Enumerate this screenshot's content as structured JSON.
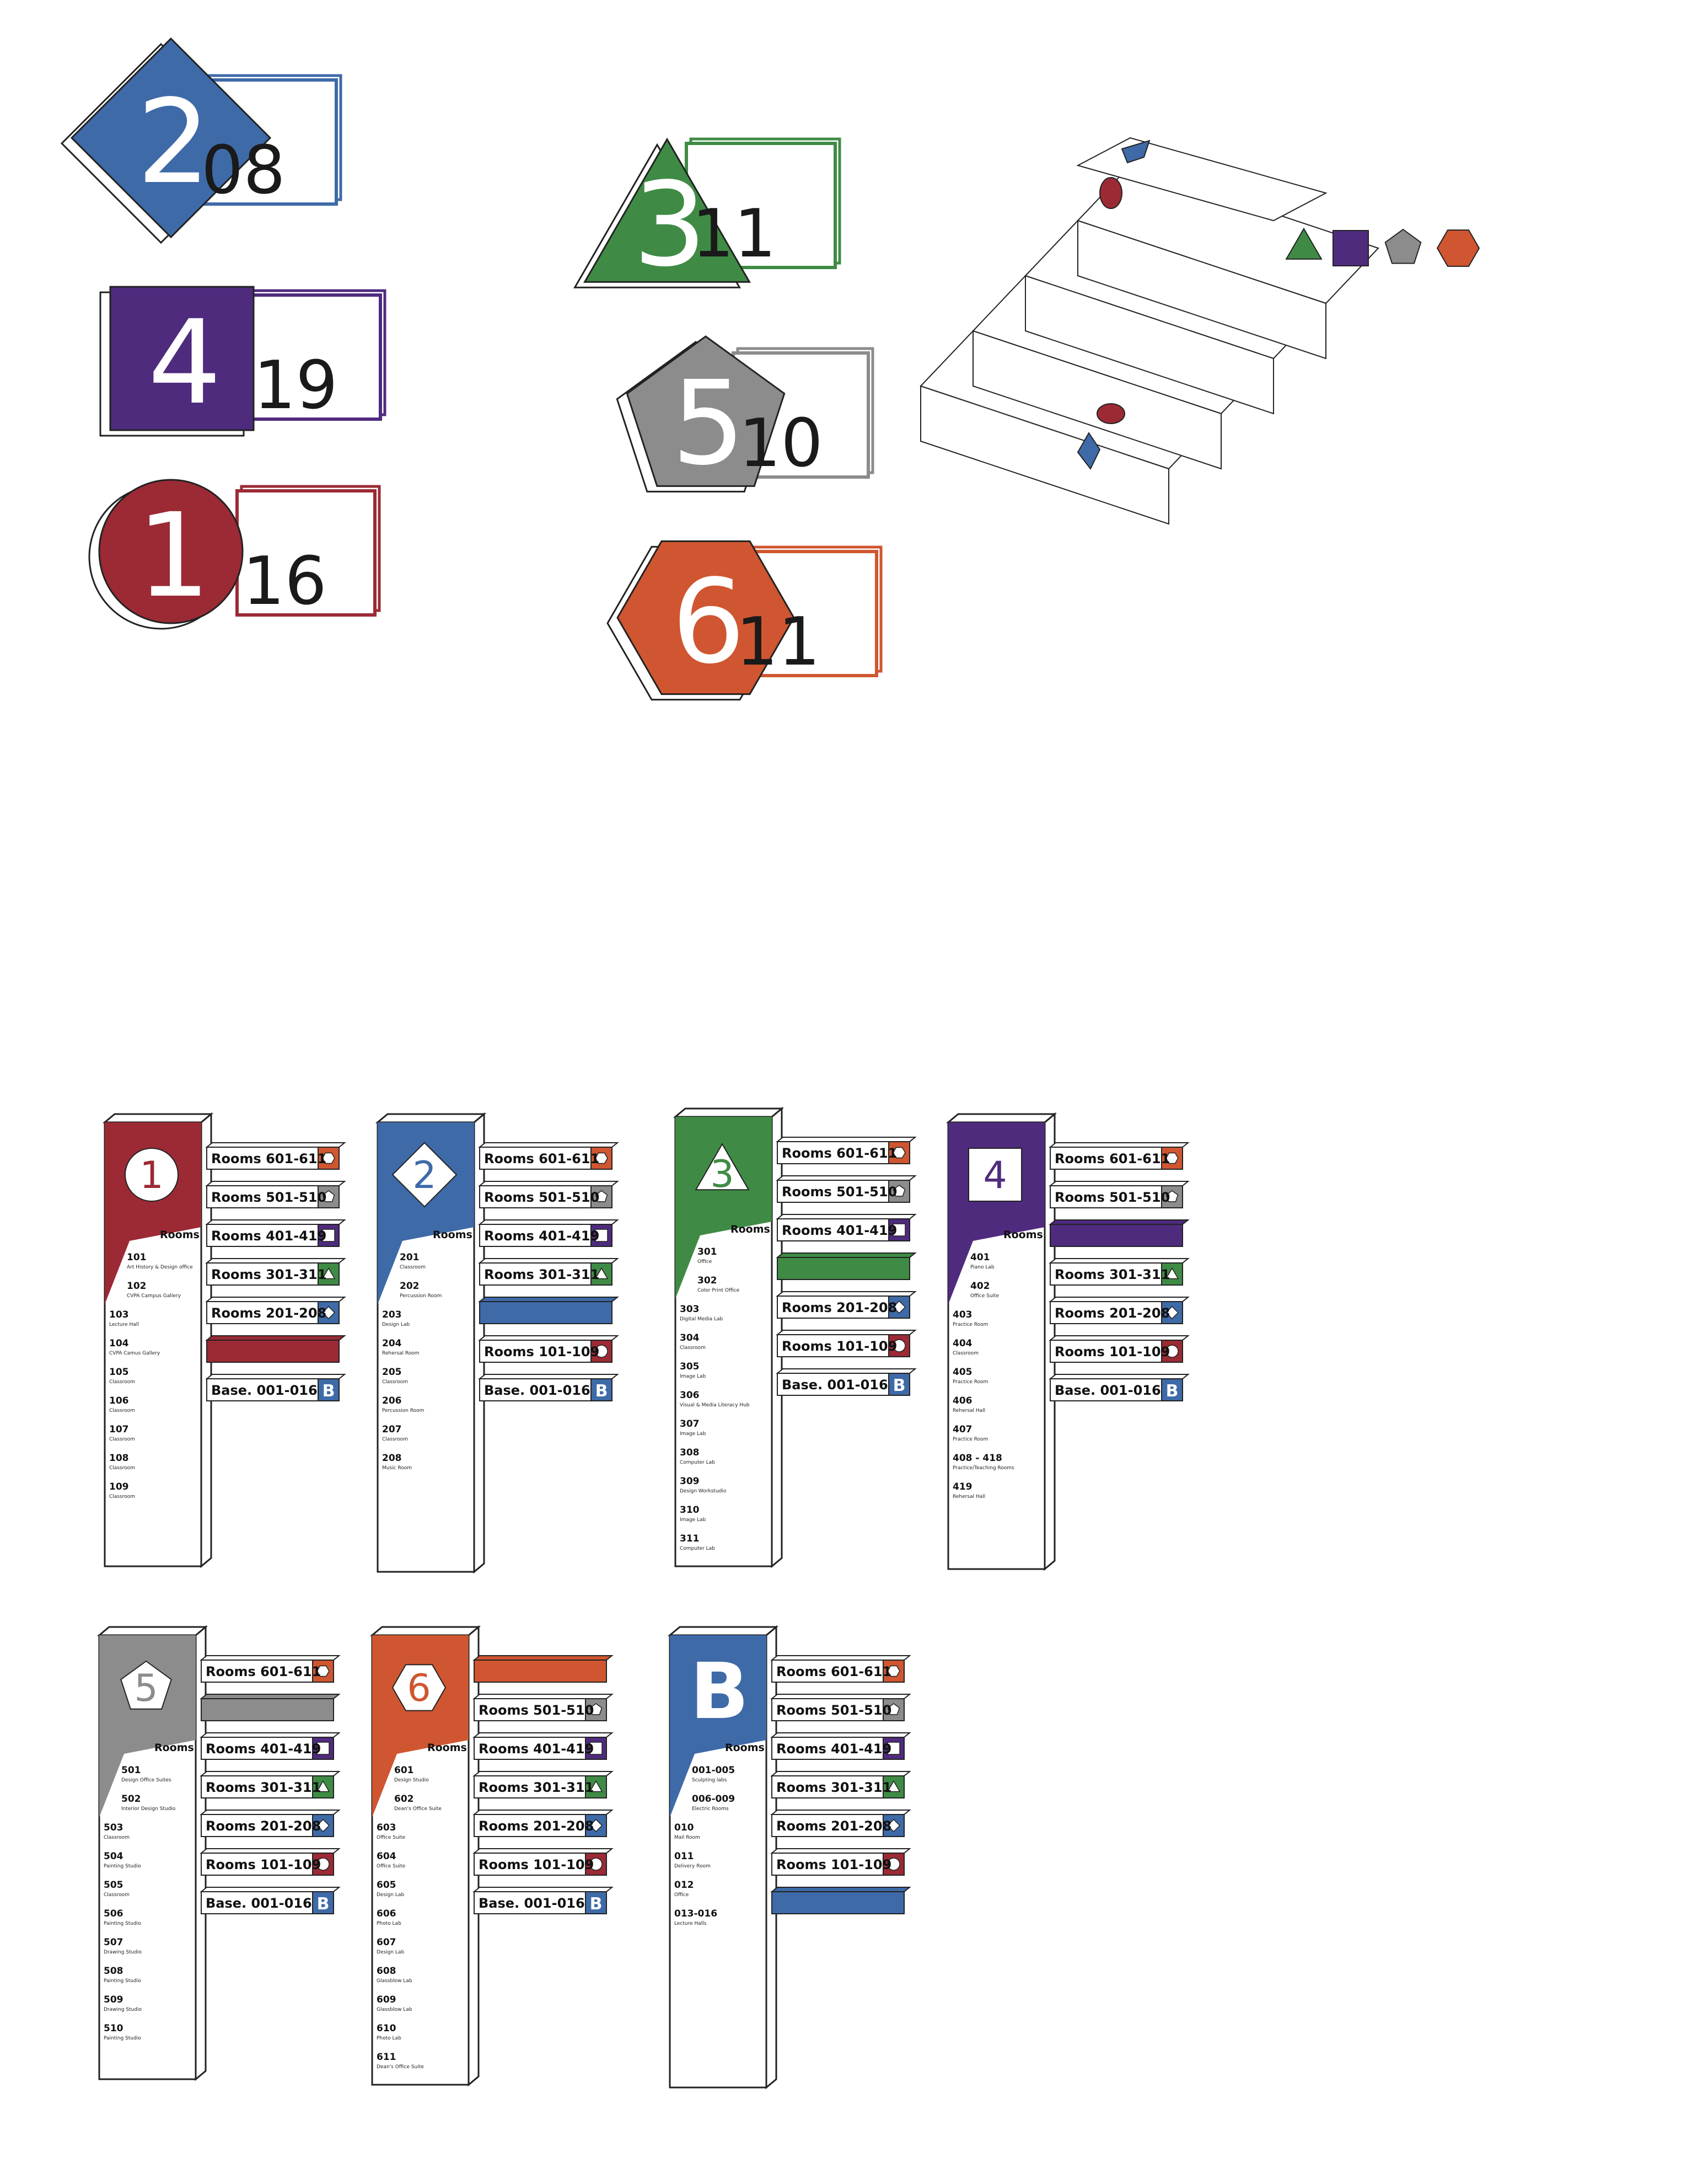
{
  "colors": {
    "floor1": "#9b2a35",
    "floor2": "#3e6aa8",
    "floor3": "#3f8b45",
    "floor4": "#4f2b7e",
    "floor5": "#8c8c8c",
    "floor6": "#cf5630",
    "basement": "#3e6aa8",
    "outline": "#222222"
  },
  "floor_badges": [
    {
      "floor": "2",
      "rooms": "08",
      "shape": "diamond",
      "color_key": "floor2"
    },
    {
      "floor": "4",
      "rooms": "19",
      "shape": "square",
      "color_key": "floor4"
    },
    {
      "floor": "1",
      "rooms": "16",
      "shape": "circle",
      "color_key": "floor1"
    },
    {
      "floor": "3",
      "rooms": "11",
      "shape": "triangle",
      "color_key": "floor3"
    },
    {
      "floor": "5",
      "rooms": "10",
      "shape": "pentagon",
      "color_key": "floor5"
    },
    {
      "floor": "6",
      "rooms": "11",
      "shape": "hexagon",
      "color_key": "floor6"
    }
  ],
  "stairs_legend": [
    "triangle",
    "square",
    "pentagon",
    "hexagon"
  ],
  "tab_labels": {
    "6": "Rooms 601-611",
    "5": "Rooms 501-510",
    "4": "Rooms 401-419",
    "3": "Rooms 301-311",
    "2": "Rooms 201-208",
    "1": "Rooms 101-109",
    "B": "Base. 001-016"
  },
  "tab_order": [
    "6",
    "5",
    "4",
    "3",
    "2",
    "1",
    "B"
  ],
  "basement_badge": "B",
  "rooms_heading": "Rooms",
  "totems": [
    {
      "floor": "1",
      "shape": "circle",
      "color_key": "floor1",
      "rooms": [
        {
          "num": "101",
          "name": "Art History & Design office"
        },
        {
          "num": "102",
          "name": "CVPA Campus Gallery"
        },
        {
          "num": "103",
          "name": "Lecture Hall"
        },
        {
          "num": "104",
          "name": "CVPA Camus Gallery"
        },
        {
          "num": "105",
          "name": "Classroom"
        },
        {
          "num": "106",
          "name": "Classroom"
        },
        {
          "num": "107",
          "name": "Classroom"
        },
        {
          "num": "108",
          "name": "Classroom"
        },
        {
          "num": "109",
          "name": "Classroom"
        }
      ]
    },
    {
      "floor": "2",
      "shape": "diamond",
      "color_key": "floor2",
      "rooms": [
        {
          "num": "201",
          "name": "Classroom"
        },
        {
          "num": "202",
          "name": "Percussion Room"
        },
        {
          "num": "203",
          "name": "Design Lab"
        },
        {
          "num": "204",
          "name": "Rehersal Room"
        },
        {
          "num": "205",
          "name": "Classroom"
        },
        {
          "num": "206",
          "name": "Percussion Room"
        },
        {
          "num": "207",
          "name": "Classroom"
        },
        {
          "num": "208",
          "name": "Music Room"
        }
      ]
    },
    {
      "floor": "3",
      "shape": "triangle",
      "color_key": "floor3",
      "rooms": [
        {
          "num": "301",
          "name": "Office"
        },
        {
          "num": "302",
          "name": "Color Print Office"
        },
        {
          "num": "303",
          "name": "Digital Media Lab"
        },
        {
          "num": "304",
          "name": "Classroom"
        },
        {
          "num": "305",
          "name": "Image Lab"
        },
        {
          "num": "306",
          "name": "Visual & Media Literacy Hub"
        },
        {
          "num": "307",
          "name": "Image Lab"
        },
        {
          "num": "308",
          "name": "Computer Lab"
        },
        {
          "num": "309",
          "name": "Design Workstudio"
        },
        {
          "num": "310",
          "name": "Image Lab"
        },
        {
          "num": "311",
          "name": "Computer Lab"
        }
      ]
    },
    {
      "floor": "4",
      "shape": "square",
      "color_key": "floor4",
      "rooms": [
        {
          "num": "401",
          "name": "Piano Lab"
        },
        {
          "num": "402",
          "name": "Office Suite"
        },
        {
          "num": "403",
          "name": "Practice Room"
        },
        {
          "num": "404",
          "name": "Classroom"
        },
        {
          "num": "405",
          "name": "Practice Room"
        },
        {
          "num": "406",
          "name": "Rehersal Hall"
        },
        {
          "num": "407",
          "name": "Practice Room"
        },
        {
          "num": "408 - 418",
          "name": "Practice/Teaching Rooms"
        },
        {
          "num": "419",
          "name": "Rehersal Hall"
        }
      ]
    },
    {
      "floor": "5",
      "shape": "pentagon",
      "color_key": "floor5",
      "rooms": [
        {
          "num": "501",
          "name": "Design Office Suites"
        },
        {
          "num": "502",
          "name": "Interior Design Studio"
        },
        {
          "num": "503",
          "name": "Classroom"
        },
        {
          "num": "504",
          "name": "Painting Studio"
        },
        {
          "num": "505",
          "name": "Classroom"
        },
        {
          "num": "506",
          "name": "Painting Studio"
        },
        {
          "num": "507",
          "name": "Drawing Studio"
        },
        {
          "num": "508",
          "name": "Painting Studio"
        },
        {
          "num": "509",
          "name": "Drawing Studio"
        },
        {
          "num": "510",
          "name": "Painting Studio"
        }
      ]
    },
    {
      "floor": "6",
      "shape": "hexagon",
      "color_key": "floor6",
      "rooms": [
        {
          "num": "601",
          "name": "Design Studio"
        },
        {
          "num": "602",
          "name": "Dean's Office Suite"
        },
        {
          "num": "603",
          "name": "Office Suite"
        },
        {
          "num": "604",
          "name": "Office Suite"
        },
        {
          "num": "605",
          "name": "Design Lab"
        },
        {
          "num": "606",
          "name": "Photo Lab"
        },
        {
          "num": "607",
          "name": "Design Lab"
        },
        {
          "num": "608",
          "name": "Glassblow Lab"
        },
        {
          "num": "609",
          "name": "Glassblow Lab"
        },
        {
          "num": "610",
          "name": "Photo Lab"
        },
        {
          "num": "611",
          "name": "Dean's Office Suite"
        }
      ]
    },
    {
      "floor": "B",
      "shape": "none",
      "color_key": "basement",
      "rooms": [
        {
          "num": "001-005",
          "name": "Sculpting labs"
        },
        {
          "num": "006-009",
          "name": "Electric Rooms"
        },
        {
          "num": "010",
          "name": "Mail Room"
        },
        {
          "num": "011",
          "name": "Delivery Room"
        },
        {
          "num": "012",
          "name": "Office"
        },
        {
          "num": "013-016",
          "name": "Lecture Halls"
        }
      ]
    }
  ]
}
